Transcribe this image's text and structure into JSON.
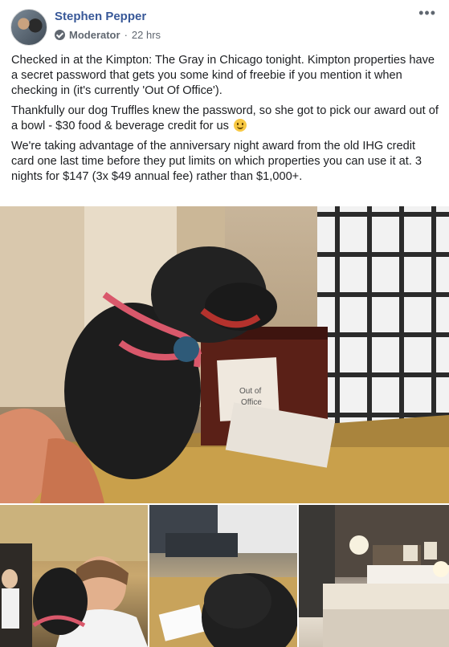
{
  "post": {
    "author": "Stephen Pepper",
    "role": "Moderator",
    "separator": "·",
    "time": "22 hrs",
    "more": "•••",
    "paragraphs": [
      "Checked in at the Kimpton: The Gray in Chicago tonight. Kimpton properties have a secret password that gets you some kind of freebie if you mention it when checking in (it's currently 'Out Of Office').",
      "Thankfully our dog Truffles knew the password, so she got to pick our award out of a bowl - $30 food & beverage credit for us",
      "We're taking advantage of the anniversary night award from the old IHG credit card one last time before they put limits on which properties you can use it at. 3 nights for $147 (3x $49 annual fee) rather than $1,000+."
    ],
    "emoji": "smiley-face-emoji",
    "note_text": [
      "Out of",
      "Office"
    ]
  },
  "icons": [
    "moderator-shield-icon",
    "more-options-icon",
    "smiley-emoji"
  ]
}
